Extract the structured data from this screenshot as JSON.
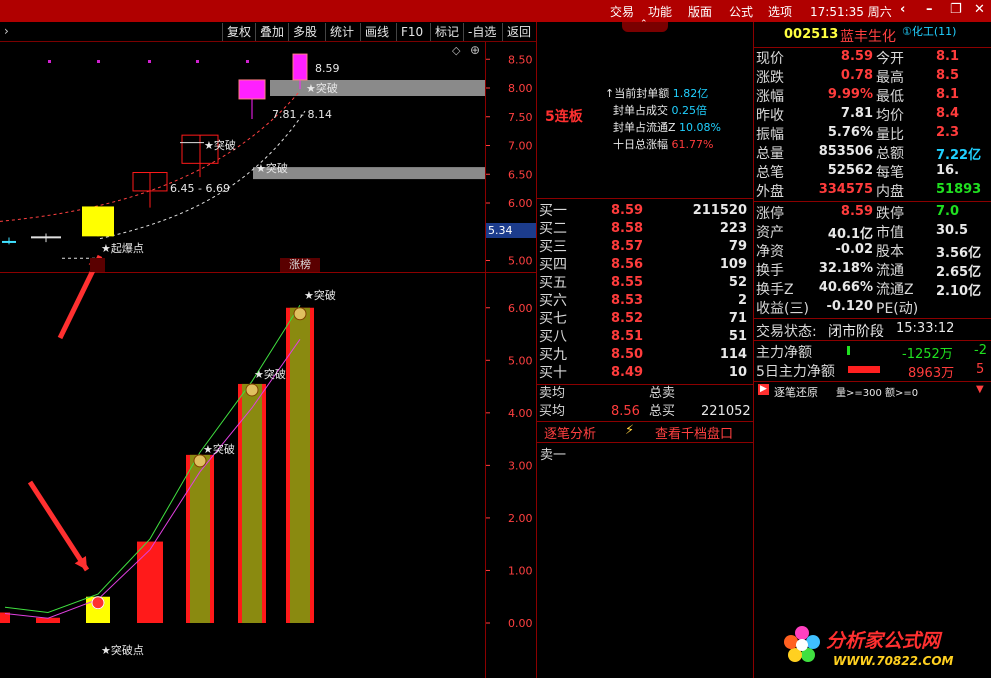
{
  "titlebar": {
    "menu": [
      "交易",
      "功能",
      "版面",
      "公式",
      "选项"
    ],
    "clock": "17:51:35 周六"
  },
  "toolbar": {
    "arrow": "›",
    "buttons": [
      "复权",
      "叠加",
      "多股",
      "统计",
      "画线",
      "F10",
      "标记",
      "-自选",
      "返回"
    ]
  },
  "chart_data": [
    {
      "type": "candlestick",
      "title": "",
      "y_ticks": [
        "8.50",
        "8.00",
        "7.50",
        "7.00",
        "6.50",
        "6.00",
        "5.50",
        "5.00"
      ],
      "ylim": [
        4.8,
        8.8
      ],
      "current_price_tag": "5.34",
      "range_labels": [
        {
          "text": "8.59"
        },
        {
          "text": "7.81 - 8.14"
        },
        {
          "text": "6.45 - 6.69"
        }
      ],
      "annotations": [
        "★突破",
        "★突破",
        "★突破",
        "★起爆点"
      ],
      "bottom_tags": [
        "涨榜"
      ],
      "candles": [
        {
          "open": 5.34,
          "close": 5.34,
          "high": 5.4,
          "low": 5.28,
          "color": "cyan"
        },
        {
          "open": 5.42,
          "close": 5.4,
          "high": 5.47,
          "low": 5.32,
          "color": "white"
        },
        {
          "open": 5.42,
          "close": 5.94,
          "high": 5.94,
          "low": 5.42,
          "color": "yellow"
        },
        {
          "open": 6.21,
          "close": 6.53,
          "high": 6.53,
          "low": 5.92,
          "color": "red-hollow"
        },
        {
          "open": 6.69,
          "close": 7.18,
          "high": 7.18,
          "low": 6.45,
          "color": "red-hollow"
        },
        {
          "open": 7.81,
          "close": 8.14,
          "high": 8.14,
          "low": 7.46,
          "color": "magenta"
        },
        {
          "open": 8.14,
          "close": 8.59,
          "high": 8.59,
          "low": 7.98,
          "color": "magenta"
        }
      ]
    },
    {
      "type": "bar",
      "title": "",
      "y_ticks": [
        "6.00",
        "5.00",
        "4.00",
        "3.00",
        "2.00",
        "1.00",
        "0.00"
      ],
      "ylim": [
        0,
        6.3
      ],
      "annotations": [
        "★突破",
        "★突破",
        "★突破",
        "★突破点"
      ],
      "values": [
        0.2,
        0.1,
        0.5,
        1.55,
        3.2,
        4.55,
        6.0
      ],
      "colors": [
        "red",
        "red",
        "yellow",
        "red",
        "olive",
        "olive",
        "olive"
      ]
    }
  ],
  "board": {
    "label": "5连板",
    "stats": [
      {
        "label": "当前封单额",
        "value": "1.82亿",
        "prefix": "↑"
      },
      {
        "label": "封单占成交",
        "value": "0.25倍"
      },
      {
        "label": "封单占流通Z",
        "value": "10.08%"
      },
      {
        "label": "十日总涨幅",
        "value": "61.77%"
      }
    ]
  },
  "orderbook": {
    "rows": [
      {
        "label": "买一",
        "price": "8.59",
        "vol": "211520"
      },
      {
        "label": "买二",
        "price": "8.58",
        "vol": "223"
      },
      {
        "label": "买三",
        "price": "8.57",
        "vol": "79"
      },
      {
        "label": "买四",
        "price": "8.56",
        "vol": "109"
      },
      {
        "label": "买五",
        "price": "8.55",
        "vol": "52"
      },
      {
        "label": "买六",
        "price": "8.53",
        "vol": "2"
      },
      {
        "label": "买七",
        "price": "8.52",
        "vol": "71"
      },
      {
        "label": "买八",
        "price": "8.51",
        "vol": "51"
      },
      {
        "label": "买九",
        "price": "8.50",
        "vol": "114"
      },
      {
        "label": "买十",
        "price": "8.49",
        "vol": "10"
      }
    ],
    "sell_avg_label": "卖均",
    "total_sell_label": "总卖",
    "buy_avg_label": "买均",
    "buy_avg": "8.56",
    "total_buy_label": "总买",
    "total_buy": "221052",
    "tick_analysis": "逐笔分析",
    "view_depth": "查看千档盘口",
    "sell_one": "卖一"
  },
  "stock": {
    "code": "002513",
    "name": "蓝丰生化",
    "sector": "①化工(11)",
    "quote_left": [
      {
        "label": "现价",
        "value": "8.59",
        "color": "red"
      },
      {
        "label": "涨跌",
        "value": "0.78",
        "color": "red"
      },
      {
        "label": "涨幅",
        "value": "9.99%",
        "color": "red"
      },
      {
        "label": "昨收",
        "value": "7.81",
        "color": "white"
      },
      {
        "label": "振幅",
        "value": "5.76%",
        "color": "white"
      },
      {
        "label": "总量",
        "value": "853506",
        "color": "white"
      },
      {
        "label": "总笔",
        "value": "52562",
        "color": "white"
      },
      {
        "label": "外盘",
        "value": "334575",
        "color": "red"
      }
    ],
    "quote_right": [
      {
        "label": "今开",
        "value": "8.1",
        "color": "red"
      },
      {
        "label": "最高",
        "value": "8.5",
        "color": "red"
      },
      {
        "label": "最低",
        "value": "8.1",
        "color": "red"
      },
      {
        "label": "均价",
        "value": "8.4",
        "color": "red"
      },
      {
        "label": "量比",
        "value": "2.3",
        "color": "red"
      },
      {
        "label": "总额",
        "value": "7.22亿",
        "color": "cyan"
      },
      {
        "label": "每笔",
        "value": "16.",
        "color": "white"
      },
      {
        "label": "内盘",
        "value": "51893",
        "color": "green"
      }
    ],
    "fund_left": [
      {
        "label": "涨停",
        "value": "8.59",
        "color": "red"
      },
      {
        "label": "资产",
        "value": "40.1亿",
        "color": "white"
      },
      {
        "label": "净资",
        "value": "-0.02",
        "color": "white"
      },
      {
        "label": "换手",
        "value": "32.18%",
        "color": "white"
      },
      {
        "label": "换手Z",
        "value": "40.66%",
        "color": "white"
      },
      {
        "label": "收益(三)",
        "value": "-0.120",
        "color": "white"
      }
    ],
    "fund_right": [
      {
        "label": "跌停",
        "value": "7.0",
        "color": "green"
      },
      {
        "label": "市值",
        "value": "30.5",
        "color": "white"
      },
      {
        "label": "股本",
        "value": "3.56亿",
        "color": "white"
      },
      {
        "label": "流通",
        "value": "2.65亿",
        "color": "white"
      },
      {
        "label": "流通Z",
        "value": "2.10亿",
        "color": "white"
      },
      {
        "label": "PE(动)",
        "value": "",
        "color": "white"
      }
    ],
    "trade_status_label": "交易状态:",
    "trade_status": "闭市阶段",
    "trade_time": "15:33:12",
    "main_net_label": "主力净额",
    "main_net": "-1252万",
    "main_net_extra": "-2",
    "main5_label": "5日主力净额",
    "main5": "8963万",
    "main5_extra": "5",
    "tick_filter": "逐笔还原",
    "filter_text": "量>=300 额>=0"
  },
  "watermark": {
    "text": "分析家公式网",
    "url": "WWW.70822.COM"
  }
}
